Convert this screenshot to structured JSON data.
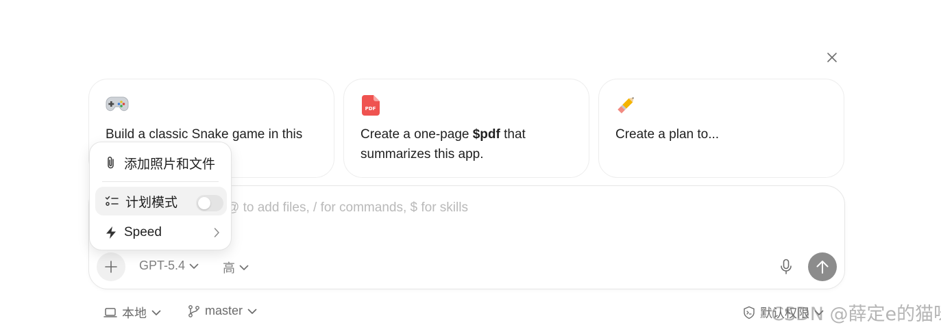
{
  "suggestions": [
    {
      "emoji": "game-controller-icon",
      "text": "Build a classic Snake game in this"
    },
    {
      "emoji": "pdf-file-icon",
      "text_before": "Create a one-page ",
      "text_bold": "$pdf",
      "text_after": " that summarizes this app."
    },
    {
      "emoji": "pencil-icon",
      "text": "Create a plan to..."
    }
  ],
  "composer": {
    "placeholder": "@ to add files, / for commands, $ for skills",
    "model": "GPT-5.4",
    "reasoning": "高"
  },
  "attach_menu": {
    "add_files": "添加照片和文件",
    "plan_mode": "计划模式",
    "plan_mode_enabled": false,
    "speed": "Speed"
  },
  "bottom_bar": {
    "location": "本地",
    "branch": "master",
    "permissions": "默认权限"
  },
  "watermark": "CSDN @薛定e的猫咪",
  "colors": {
    "send_button": "#8c8c8c",
    "pdf_icon": "#ef5350",
    "menu_highlight": "#f2f2f2"
  }
}
